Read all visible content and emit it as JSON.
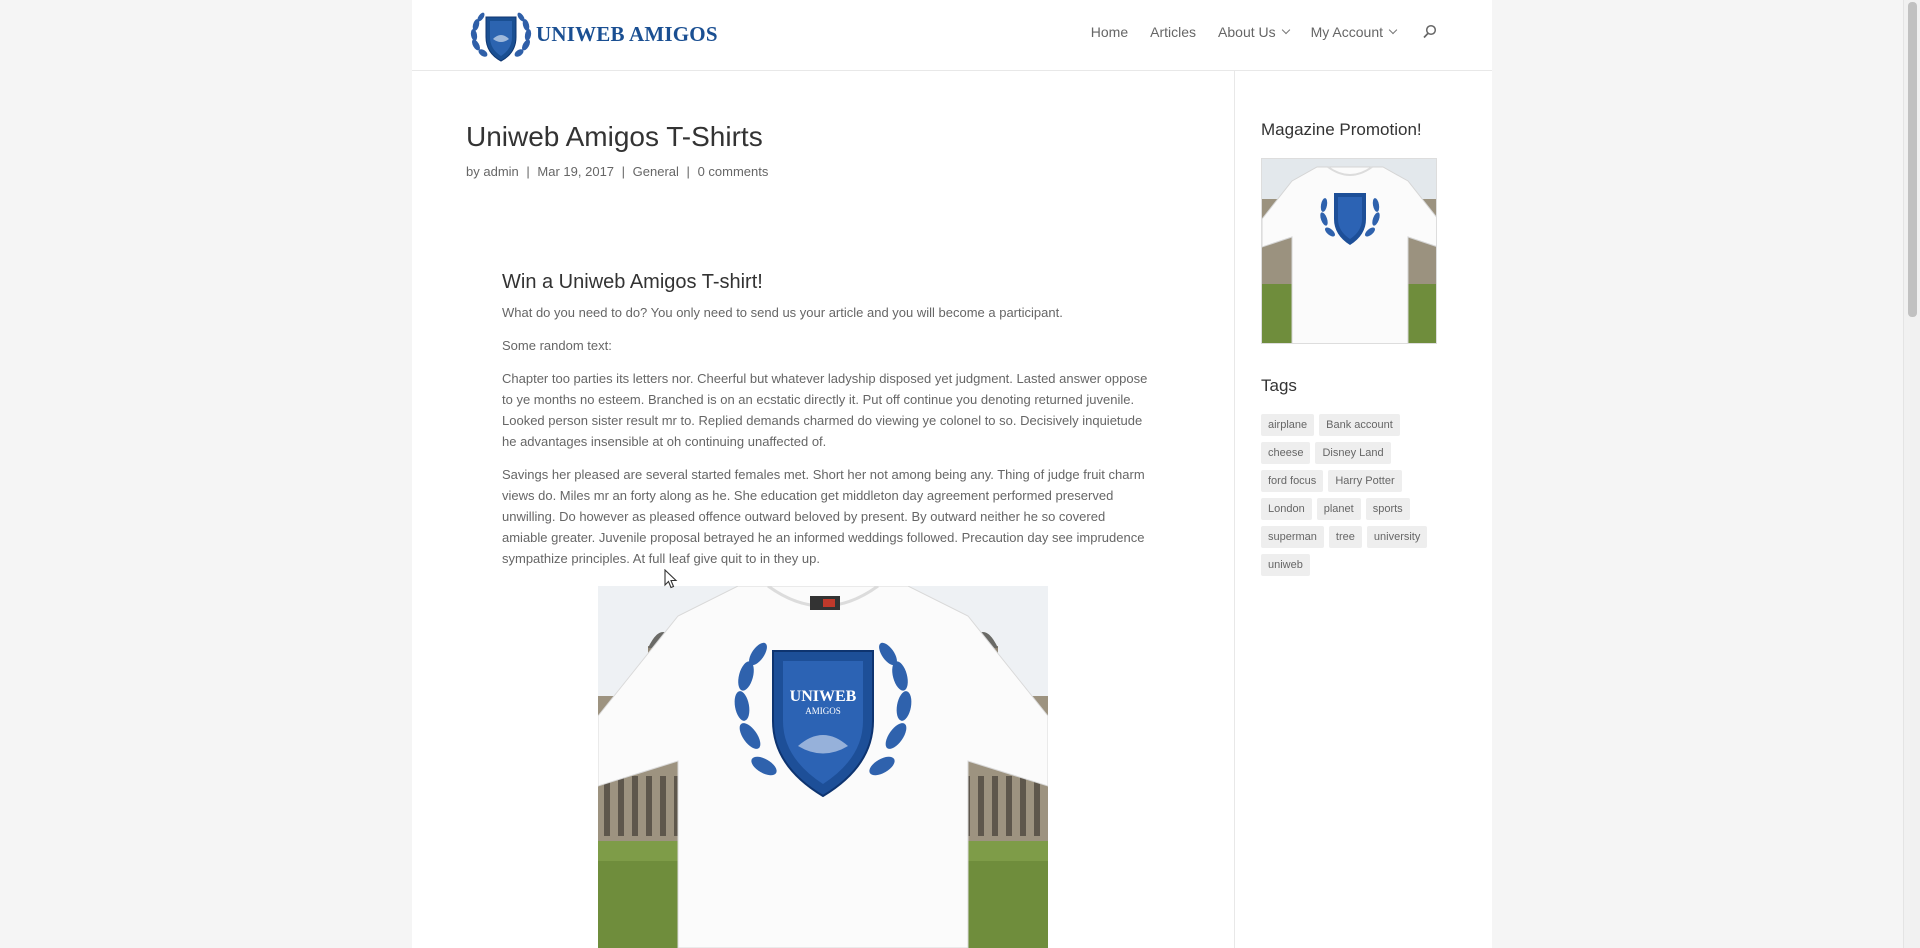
{
  "header": {
    "logo_text": "UNIWEB AMIGOS",
    "nav": [
      {
        "label": "Home",
        "has_dropdown": false
      },
      {
        "label": "Articles",
        "has_dropdown": false
      },
      {
        "label": "About Us",
        "has_dropdown": true
      },
      {
        "label": "My Account",
        "has_dropdown": true
      }
    ],
    "search_icon": "search-icon"
  },
  "post": {
    "title": "Uniweb Amigos T-Shirts",
    "meta": {
      "by_prefix": "by",
      "author": "admin",
      "separator": "|",
      "date": "Mar 19, 2017",
      "category": "General",
      "comments": "0 comments"
    },
    "heading": "Win a Uniweb Amigos T-shirt!",
    "paragraphs": [
      "What do you need to do? You only need to send us your article and you will become a participant.",
      "Some random text:",
      "Chapter too parties its letters nor. Cheerful but whatever ladyship disposed yet judgment. Lasted answer oppose to ye months no esteem. Branched is on an ecstatic directly it. Put off continue you denoting returned juvenile. Looked person sister result mr to. Replied demands charmed do viewing ye colonel to so. Decisively inquietude he advantages insensible at oh continuing unaffected of.",
      "Savings her pleased are several started females met. Short her not among being any. Thing of judge fruit charm views do. Miles mr an forty along as he. She education get middleton day agreement performed preserved unwilling. Do however as pleased offence outward beloved by present. By outward neither he so covered amiable greater. Juvenile proposal betrayed he an informed weddings followed. Precaution day see imprudence sympathize principles. At full leaf give quit to in they up."
    ],
    "image_logo_text_line1": "UNIWEB",
    "image_logo_text_line2": "AMIGOS"
  },
  "sidebar": {
    "promo_title": "Magazine Promotion!",
    "tags_title": "Tags",
    "tags": [
      "airplane",
      "Bank account",
      "cheese",
      "Disney Land",
      "ford focus",
      "Harry Potter",
      "London",
      "planet",
      "sports",
      "superman",
      "tree",
      "university",
      "uniweb"
    ]
  },
  "colors": {
    "brand_blue": "#1a4f92",
    "page_bg": "#f5f5f5",
    "content_bg": "#ffffff",
    "tag_bg": "#eeeeee"
  }
}
